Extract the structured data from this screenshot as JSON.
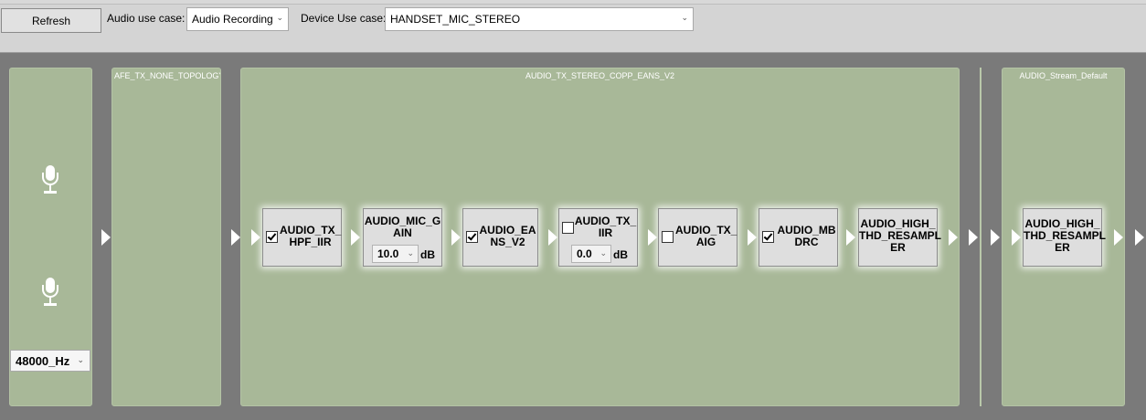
{
  "toolbar": {
    "refresh_label": "Refresh",
    "audio_use_case_label": "Audio use case:",
    "audio_use_case_value": "Audio Recording",
    "device_use_case_label": "Device Use case:",
    "device_use_case_value": "HANDSET_MIC_STEREO"
  },
  "panels": {
    "afe_title": "AFE_TX_NONE_TOPOLOGY",
    "copp_title": "AUDIO_TX_STEREO_COPP_EANS_V2",
    "stream_title": "AUDIO_Stream_Default"
  },
  "source": {
    "sample_rate": "48000_Hz",
    "mic_icons": [
      "microphone-icon",
      "microphone-icon"
    ]
  },
  "modules": [
    {
      "name_lines": [
        "AUDIO_TX_",
        "HPF_IIR"
      ],
      "checkbox": true,
      "checked": true
    },
    {
      "name_lines": [
        "AUDIO_MIC_G",
        "AIN"
      ],
      "checkbox": false,
      "gain_value": "10.0",
      "unit": "dB"
    },
    {
      "name_lines": [
        "AUDIO_EA",
        "NS_V2"
      ],
      "checkbox": true,
      "checked": true
    },
    {
      "name_lines": [
        "AUDIO_TX_",
        "IIR"
      ],
      "checkbox": true,
      "checked": false,
      "gain_value": "0.0",
      "unit": "dB"
    },
    {
      "name_lines": [
        "AUDIO_TX_",
        "AIG"
      ],
      "checkbox": true,
      "checked": false
    },
    {
      "name_lines": [
        "AUDIO_MB",
        "DRC"
      ],
      "checkbox": true,
      "checked": true
    },
    {
      "name_lines": [
        "AUDIO_HIGH_",
        "THD_RESAMPL",
        "ER"
      ],
      "checkbox": false
    }
  ],
  "stream_modules": [
    {
      "name_lines": [
        "AUDIO_HIGH_",
        "THD_RESAMPL",
        "ER"
      ]
    }
  ]
}
